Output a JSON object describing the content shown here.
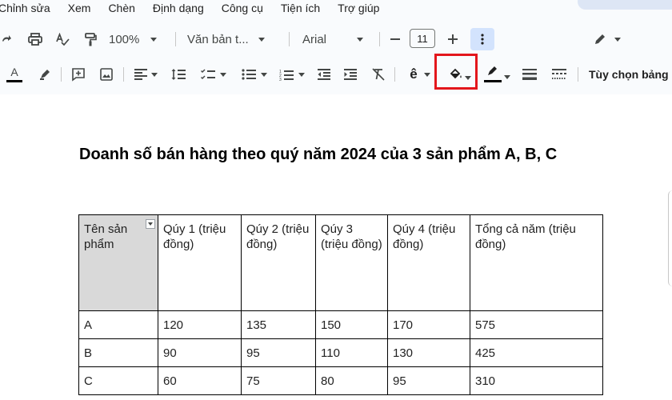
{
  "menu": [
    "Chỉnh sửa",
    "Xem",
    "Chèn",
    "Định dạng",
    "Công cụ",
    "Tiện ích",
    "Trợ giúp"
  ],
  "toolbar": {
    "zoom": "100%",
    "style": "Văn bản t...",
    "font": "Arial",
    "font_size": "11",
    "table_options": "Tùy chọn bảng"
  },
  "document": {
    "title": "Doanh số bán hàng theo quý năm 2024 của 3 sản phẩm A, B, C",
    "table": {
      "headers": [
        "Tên sản phẩm",
        "Qúy 1 (triệu đồng)",
        "Qúy 2 (triệu đồng)",
        "Qúy 3 (triệu đồng)",
        "Qúy 4 (triệu đồng)",
        "Tổng cả năm (triệu đồng)"
      ],
      "rows": [
        [
          "A",
          "120",
          "135",
          "150",
          "170",
          "575"
        ],
        [
          "B",
          "90",
          "95",
          "110",
          "130",
          "425"
        ],
        [
          "C",
          "60",
          "75",
          "80",
          "95",
          "310"
        ]
      ]
    }
  },
  "colors": {
    "highlight_border": "#e3161c",
    "header_shade": "#d9d9d9",
    "active_button": "#d3e3fd"
  }
}
